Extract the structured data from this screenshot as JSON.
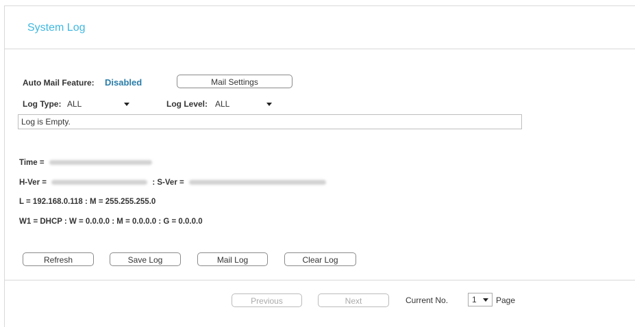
{
  "header": {
    "title": "System Log"
  },
  "mail": {
    "feature_label": "Auto Mail Feature:",
    "feature_value": "Disabled",
    "settings_button": "Mail Settings"
  },
  "filters": {
    "log_type_label": "Log Type:",
    "log_type_value": "ALL",
    "log_level_label": "Log Level:",
    "log_level_value": "ALL"
  },
  "log": {
    "content": "Log is Empty."
  },
  "info": {
    "time_label": "Time =",
    "hver_label": "H-Ver =",
    "sver_label": ": S-Ver =",
    "lan_line": "L = 192.168.0.118 : M = 255.255.255.0",
    "wan_line": "W1 = DHCP : W = 0.0.0.0 : M = 0.0.0.0 : G = 0.0.0.0"
  },
  "actions": {
    "refresh": "Refresh",
    "save_log": "Save Log",
    "mail_log": "Mail Log",
    "clear_log": "Clear Log"
  },
  "pager": {
    "previous": "Previous",
    "next": "Next",
    "current_label": "Current No.",
    "current_value": "1",
    "page_label": "Page"
  }
}
